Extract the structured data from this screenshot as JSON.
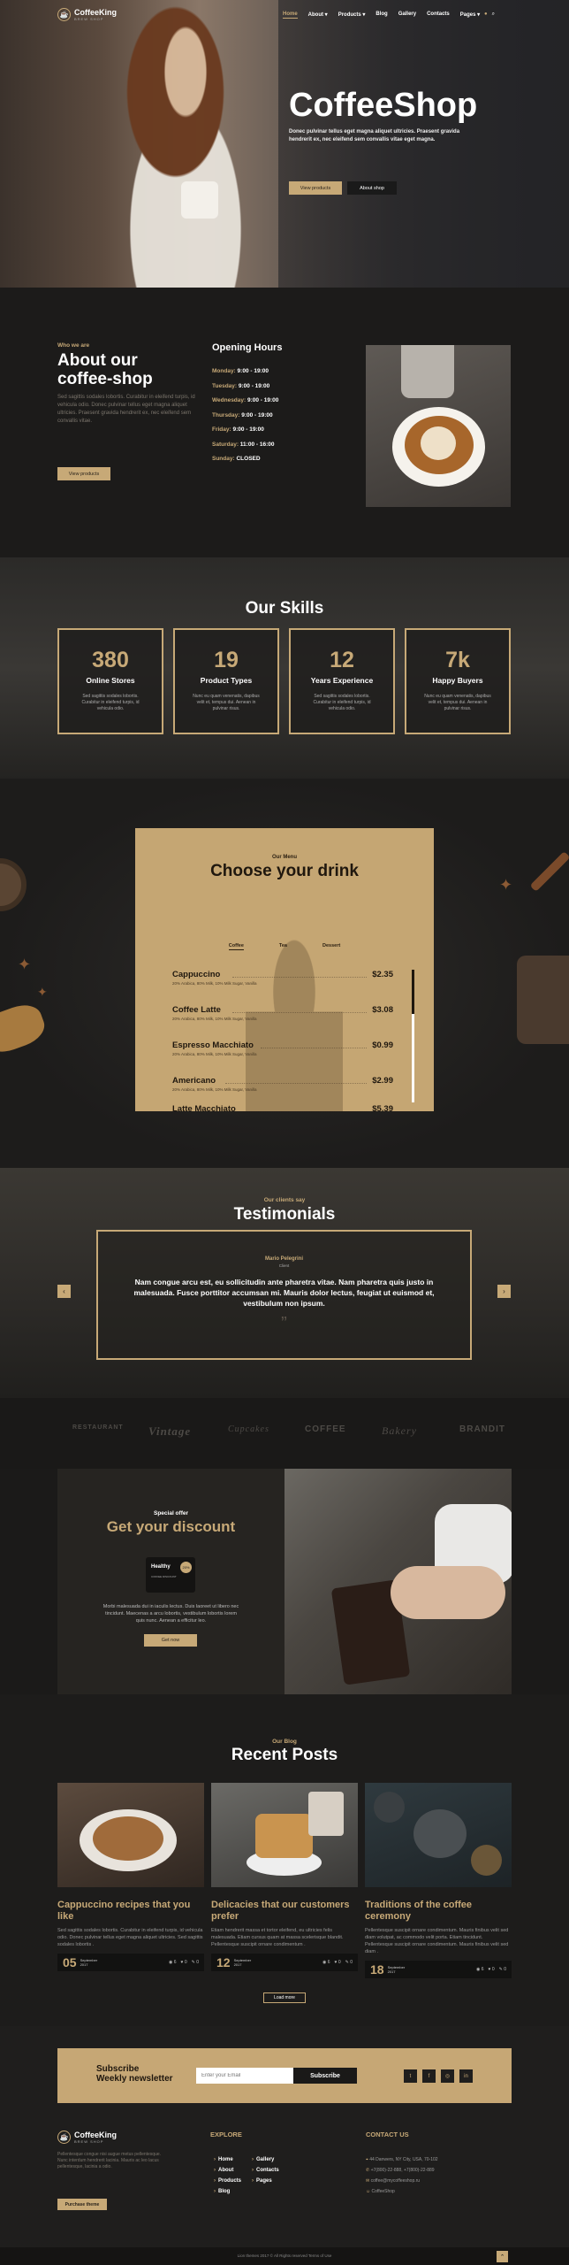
{
  "nav": {
    "logo_name": "CoffeeKing",
    "logo_sub": "BREW SHOP",
    "items": [
      "Home",
      "About",
      "Products",
      "Blog",
      "Gallery",
      "Contacts",
      "Pages"
    ],
    "active": "Home"
  },
  "hero": {
    "title": "CoffeeShop",
    "text": "Donec pulvinar tellus eget magna aliquet ultricies. Praesent gravida hendrerit ex, nec eleifend sem convallis vitae eget magna.",
    "btn_primary": "View products",
    "btn_secondary": "About shop"
  },
  "about": {
    "eyebrow": "Who we are",
    "title_line1": "About our",
    "title_line2": "coffee-shop",
    "text": "Sed sagittis sodales lobortis. Curabitur in eleifend turpis, id vehicula odio. Donec pulvinar tellus eget magna aliquet ultricies. Praesent gravida hendrerit ex, nec eleifend sem convallis vitae.",
    "button": "View products",
    "hours_title": "Opening Hours",
    "hours": [
      {
        "day": "Monday:",
        "time": "9:00 - 19:00"
      },
      {
        "day": "Tuesday:",
        "time": "9:00 - 19:00"
      },
      {
        "day": "Wednesday:",
        "time": "9:00 - 19:00"
      },
      {
        "day": "Thursday:",
        "time": "9:00 - 19:00"
      },
      {
        "day": "Friday:",
        "time": "9:00 - 19:00"
      },
      {
        "day": "Saturday:",
        "time": "11:00 - 16:00"
      },
      {
        "day": "Sunday:",
        "time": "CLOSED"
      }
    ]
  },
  "skills": {
    "title": "Our Skills",
    "items": [
      {
        "num": "380",
        "label": "Online Stores",
        "desc": "Sed sagittis sodales lobortis. Curabitur in eleifend turpis, id vehicula odio."
      },
      {
        "num": "19",
        "label": "Product Types",
        "desc": "Nunc eu quam venenatis, dapibus velit et, tempus dui. Aenean in pulvinar risus."
      },
      {
        "num": "12",
        "label": "Years Experience",
        "desc": "Sed sagittis sodales lobortis. Curabitur in eleifend turpis, id vehicula odio."
      },
      {
        "num": "7k",
        "label": "Happy Buyers",
        "desc": "Nunc eu quam venenatis, dapibus velit et, tempus dui. Aenean in pulvinar risus."
      }
    ]
  },
  "drinks": {
    "eyebrow": "Our Menu",
    "title": "Choose your drink",
    "tabs": [
      "Coffee",
      "Tea",
      "Dessert"
    ],
    "items": [
      {
        "name": "Cappuccino",
        "price": "$2.35",
        "desc": "20% Arabica, 80% Milk, 10% Milk Sugar, Vanilla"
      },
      {
        "name": "Coffee Latte",
        "price": "$3.08",
        "desc": "20% Arabica, 80% Milk, 10% Milk Sugar, Vanilla"
      },
      {
        "name": "Espresso Macchiato",
        "price": "$0.99",
        "desc": "20% Arabica, 80% Milk, 10% Milk Sugar, Vanilla"
      },
      {
        "name": "Americano",
        "price": "$2.99",
        "desc": "20% Arabica, 80% Milk, 10% Milk Sugar, Vanilla"
      },
      {
        "name": "Latte Macchiato",
        "price": "$5.39",
        "desc": "20% Arabica, 80% Milk, 10% Milk Sugar, Vanilla"
      }
    ]
  },
  "testimonials": {
    "eyebrow": "Our clients say",
    "title": "Testimonials",
    "author": "Mario Pelegrini",
    "role": "Client",
    "quote": "Nam congue arcu est, eu sollicitudin ante pharetra vitae. Nam pharetra quis justo in malesuada. Fusce porttitor accumsan mi. Mauris dolor lectus, feugiat ut euismod et, vestibulum non ipsum."
  },
  "brands": [
    "RESTAURANT",
    "Vintage",
    "Cupcakes",
    "COFFEE",
    "Bakery",
    "BRANDIT"
  ],
  "discount": {
    "eyebrow": "Special offer",
    "title": "Get your discount",
    "card_title": "Healthy",
    "card_sub": "COFFEE DISCOUNT",
    "card_badge": "20%",
    "text": "Morbi malesuada dui in iaculis lectus. Duis laoreet ut libero nec tincidunt. Maecenas a arcu lobortis, vestibulum lobortis lorem quis nunc. Aenean a efficitur leo.",
    "button": "Get now"
  },
  "blog": {
    "eyebrow": "Our Blog",
    "title": "Recent Posts",
    "posts": [
      {
        "title": "Cappuccino recipes that you like",
        "text": "Sed sagittis sodales lobortis. Curabitur in eleifend turpis, id vehicula odio. Donec pulvinar tellus eget magna aliquet ultricies. Sed sagittis sodales lobortis .",
        "day": "05",
        "month": "September",
        "year": "2017",
        "views": "6",
        "likes": "0",
        "comments": "0"
      },
      {
        "title": "Delicacies that our customers prefer",
        "text": "Etiam hendrerit massa et tortor eleifend, eu ultricies felis malesuada. Etiam cursus quam at massa scelerisque blandit. Pellentesque suscipit ornare condimentum .",
        "day": "12",
        "month": "September",
        "year": "2017",
        "views": "6",
        "likes": "0",
        "comments": "0"
      },
      {
        "title": "Traditions of the coffee ceremony",
        "text": "Pellentesque suscipit ornare condimentum. Mauris finibus velit sed diam volutpat, ac commodo velit porta. Etiam tincidunt. Pellentesque suscipit ornare condimentum. Mauris finibus velit sed diam .",
        "day": "18",
        "month": "September",
        "year": "2017",
        "views": "6",
        "likes": "0",
        "comments": "0"
      }
    ],
    "more": "Load more"
  },
  "newsletter": {
    "title_line1": "Subscribe",
    "title_line2": "Weekly newsletter",
    "placeholder": "Enter your Email",
    "button": "Subscribe",
    "social": [
      "tw",
      "fb",
      "ig",
      "in"
    ]
  },
  "footer": {
    "about": "Pellentesque congue nisi augue metus pellentesque. Nunc interdum hendrerit lacinia. Mauris ac leo lacus pellentesque, lacinia a odio.",
    "button": "Purchase theme",
    "explore_title": "EXPLORE",
    "explore_col1": [
      "Home",
      "About",
      "Products",
      "Blog"
    ],
    "explore_col2": [
      "Gallery",
      "Contacts",
      "Pages"
    ],
    "contact_title": "CONTACT US",
    "contacts": [
      "44 Danwers, NY City, USA, 70-102",
      "+7(800)-22-888, +7(800)-22-889",
      "coffee@mycoffeeshop.ru",
      "CoffeeShop"
    ],
    "copyright": "Lion themes 2017 © All Rights reserved Terms of Use"
  }
}
